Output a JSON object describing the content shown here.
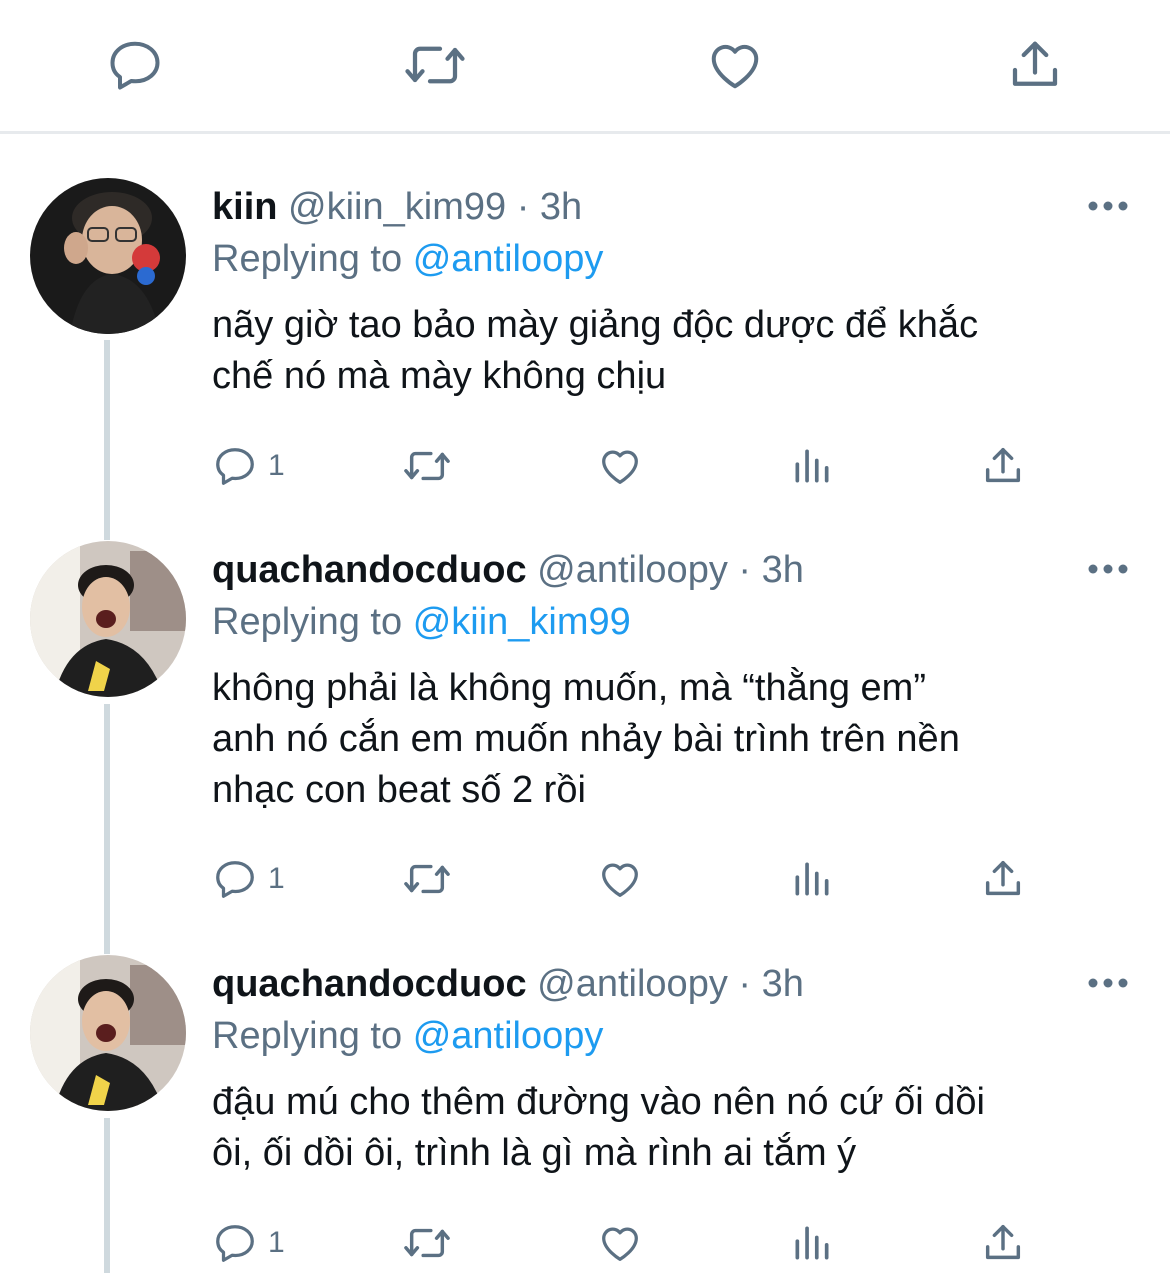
{
  "top_actions": {
    "reply_icon": "reply-icon",
    "retweet_icon": "retweet-icon",
    "like_icon": "heart-icon",
    "share_icon": "share-icon"
  },
  "tweets": [
    {
      "name": "kiin",
      "handle": "@kiin_kim99",
      "separator": "·",
      "time": "3h",
      "replying_prefix": "Replying to",
      "replying_to": "@antiloopy",
      "text_lines": [
        "nãy giờ tao bảo mày giảng độc dược để khắc",
        "chế nó mà mày không chịu"
      ],
      "reply_count": "1"
    },
    {
      "name": "quachandocduoc",
      "handle": "@antiloopy",
      "separator": "·",
      "time": "3h",
      "replying_prefix": "Replying to",
      "replying_to": "@kiin_kim99",
      "text_lines": [
        "không phải là không muốn, mà “thằng em”",
        "anh nó cắn em muốn nhảy bài trình trên nền",
        "nhạc con beat số 2 rồi"
      ],
      "reply_count": "1"
    },
    {
      "name": "quachandocduoc",
      "handle": "@antiloopy",
      "separator": "·",
      "time": "3h",
      "replying_prefix": "Replying to",
      "replying_to": "@antiloopy",
      "text_lines": [
        "đậu mú cho thêm đường vào nên nó cứ ối dồi",
        "ôi, ối dồi ôi, trình là gì mà rình ai tắm ý"
      ],
      "reply_count": "1"
    }
  ],
  "colors": {
    "accent": "#1d9bf0",
    "muted": "#5b7083",
    "text": "#0f1419",
    "divider": "#e7eaed",
    "thread": "#cfd9de"
  }
}
